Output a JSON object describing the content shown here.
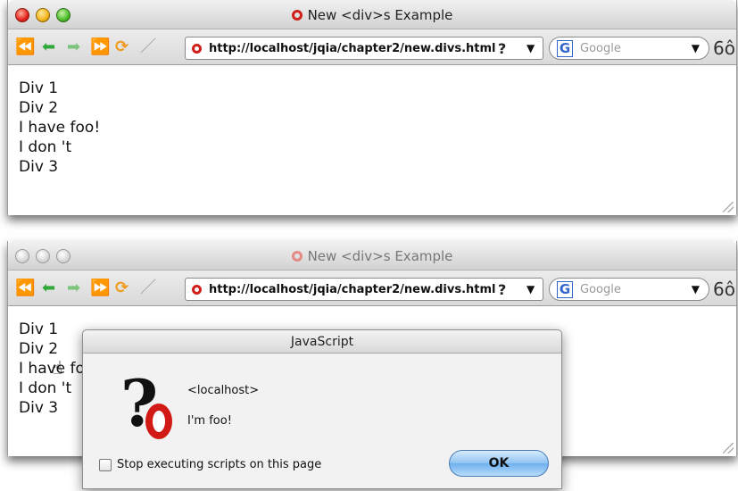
{
  "browser_top": {
    "title": "New <div>s Example",
    "url": "http://localhost/jqia/chapter2/new.divs.html",
    "url_help": "?",
    "url_dropdown": "▼",
    "search_placeholder": "Google",
    "search_dropdown": "▼",
    "content_lines": [
      "Div 1",
      "Div 2",
      "I have foo!",
      "I don 't",
      "Div 3"
    ]
  },
  "browser_bottom": {
    "title": "New <div>s Example",
    "url": "http://localhost/jqia/chapter2/new.divs.html",
    "url_help": "?",
    "url_dropdown": "▼",
    "search_placeholder": "Google",
    "search_dropdown": "▼",
    "content_lines": [
      "Div 1",
      "Div 2",
      "I have foo!",
      "I don 't",
      "Div 3"
    ]
  },
  "dialog": {
    "title": "JavaScript",
    "host": "<localhost>",
    "message": "I'm foo!",
    "checkbox_label": "Stop executing scripts on this page",
    "ok_label": "OK"
  },
  "toolbar_icons": {
    "back": "⏪",
    "prev": "⬅",
    "next": "➡",
    "fast_forward": "⏩",
    "reload": "⟳",
    "wand": "／",
    "binoculars": "6ô",
    "google": "G",
    "question": "?",
    "cursor": "☝"
  }
}
